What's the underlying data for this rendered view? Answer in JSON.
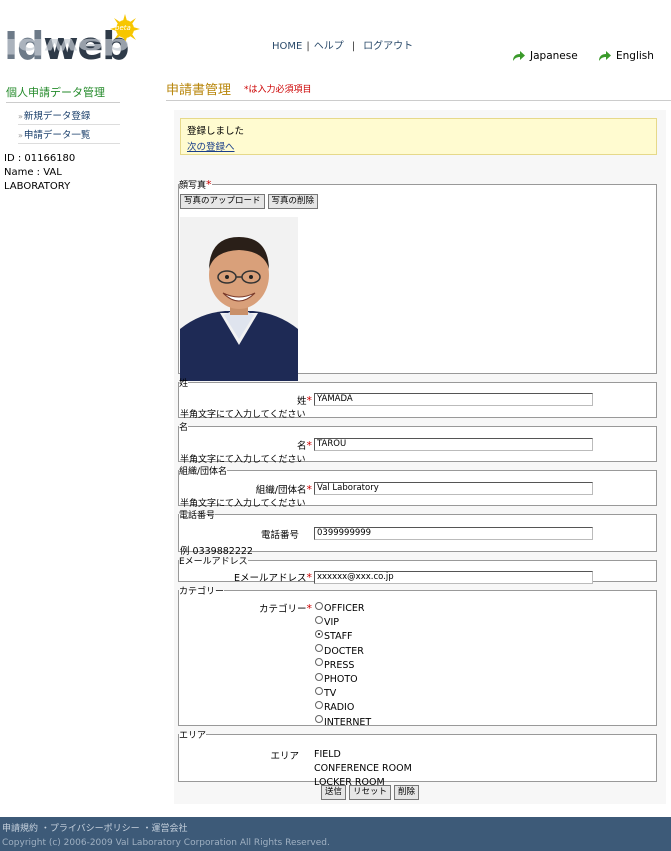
{
  "logo": {
    "text_a": "Id",
    "text_b": "web",
    "badge": "beta"
  },
  "topnav": {
    "home": "HOME",
    "help": "ヘルプ",
    "logout": "ログアウト"
  },
  "lang": {
    "japanese": "Japanese",
    "english": "English"
  },
  "sidebar": {
    "title": "個人申請データ管理",
    "items": [
      {
        "label": "新規データ登録"
      },
      {
        "label": "申請データ一覧"
      }
    ],
    "id_line": "ID : 01166180",
    "name_line": "Name : VAL",
    "name_line2": "LABORATORY"
  },
  "main": {
    "title": "申請書管理",
    "required_note": "*は入力必須項目"
  },
  "notice": {
    "message": "登録しました",
    "link": "次の登録へ"
  },
  "photo": {
    "legend": "顔写真",
    "upload_button": "写真のアップロード",
    "delete_button": "写真の削除"
  },
  "fields": {
    "last_name": {
      "legend": "姓",
      "label": "姓",
      "value": "YAMADA",
      "hint": "半角文字にて入力してください"
    },
    "first_name": {
      "legend": "名",
      "label": "名",
      "value": "TAROU",
      "hint": "半角文字にて入力してください"
    },
    "org": {
      "legend": "組織/団体名",
      "label": "組織/団体名",
      "value": "Val Laboratory",
      "hint": "半角文字にて入力してください"
    },
    "phone": {
      "legend": "電話番号",
      "label": "電話番号",
      "value": "0399999999",
      "hint": "例 0339882222"
    },
    "email": {
      "legend": "Eメールアドレス",
      "label": "Eメールアドレス",
      "value": "xxxxxx@xxx.co.jp"
    }
  },
  "category": {
    "legend": "カテゴリー",
    "label": "カテゴリー",
    "options": [
      "OFFICER",
      "VIP",
      "STAFF",
      "DOCTER",
      "PRESS",
      "PHOTO",
      "TV",
      "RADIO",
      "INTERNET"
    ],
    "selected": "STAFF"
  },
  "area": {
    "legend": "エリア",
    "label": "エリア",
    "values": [
      "FIELD",
      "CONFERENCE ROOM",
      "LOCKER ROOM"
    ]
  },
  "actions": {
    "submit": "送信",
    "reset": "リセット",
    "delete": "削除"
  },
  "footer": {
    "links": "申請規約 ・プライバシーポリシー ・運営会社",
    "copyright": "Copyright (c) 2006-2009 Val Laboratory Corporation All Rights Reserved."
  },
  "colors": {
    "accent_green": "#238a2a",
    "required_red": "#cc0000",
    "footer_bg": "#3d5a78",
    "notice_bg": "#fffbd0"
  }
}
